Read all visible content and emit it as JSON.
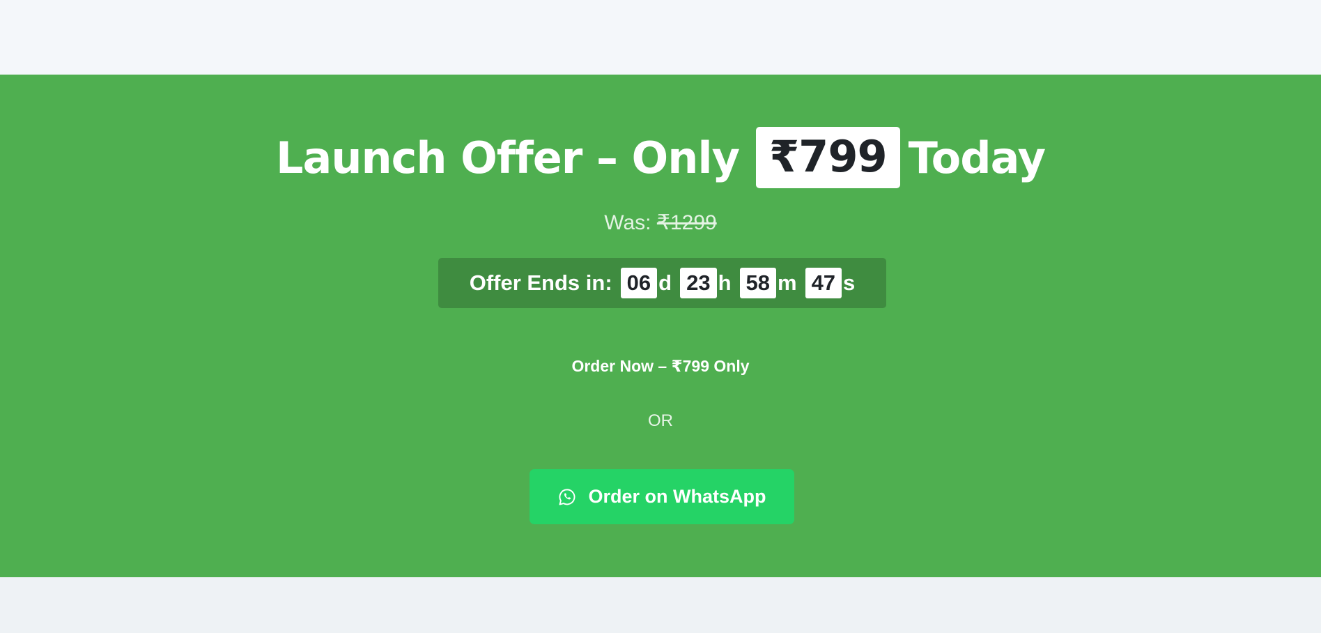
{
  "offer": {
    "headline_prefix": "Launch Offer – Only",
    "price": "₹799",
    "headline_suffix": "Today",
    "was_label": "Was:",
    "was_price": "₹1299"
  },
  "countdown": {
    "label": "Offer Ends in:",
    "days": "06",
    "days_suffix": "d",
    "hours": "23",
    "hours_suffix": "h",
    "minutes": "58",
    "minutes_suffix": "m",
    "seconds": "47",
    "seconds_suffix": "s"
  },
  "actions": {
    "order_now_label": "Order Now – ₹799 Only",
    "or_text": "OR",
    "whatsapp_label": "Order on WhatsApp",
    "whatsapp_icon": "whatsapp-icon"
  },
  "colors": {
    "section_background": "#4faf50",
    "timer_background": "#3f8c40",
    "whatsapp_green": "#25d366"
  }
}
